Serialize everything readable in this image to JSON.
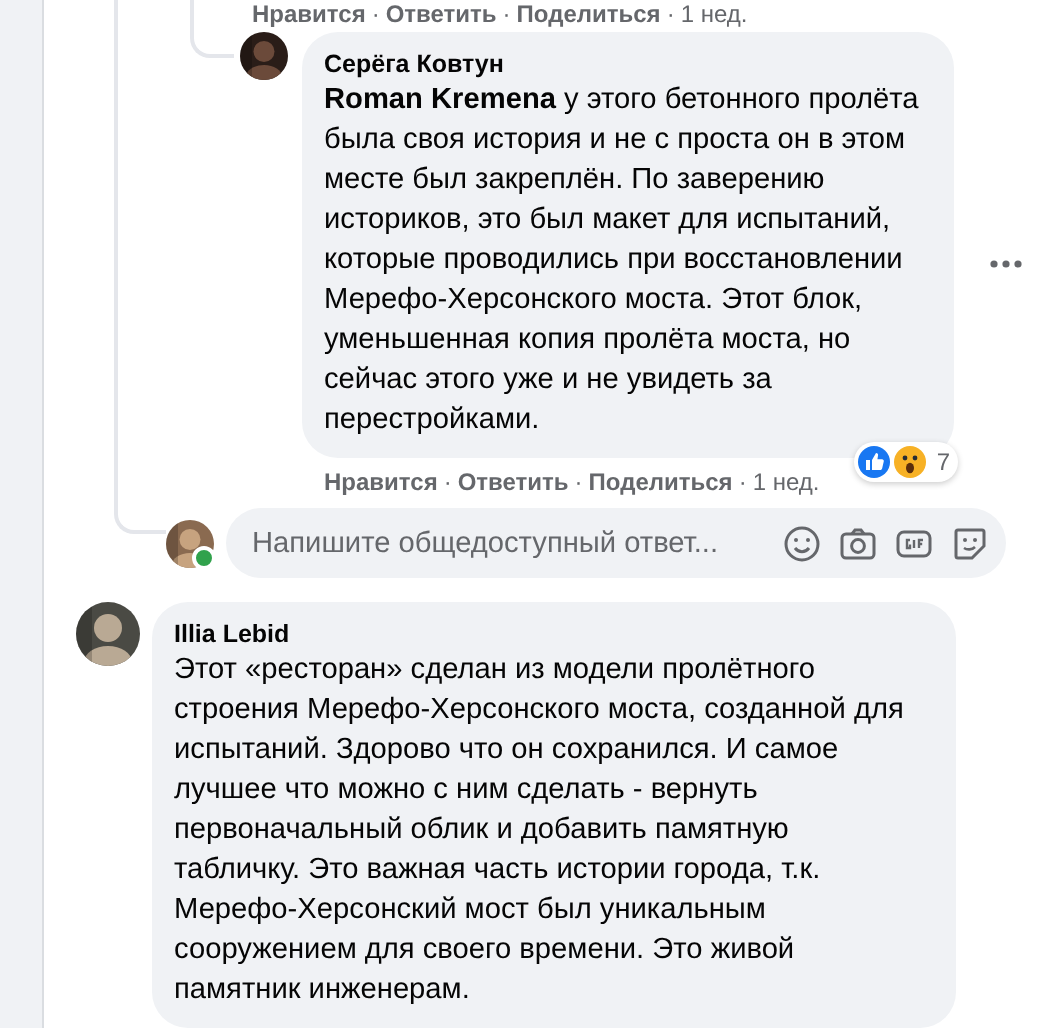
{
  "top_actions": {
    "like": "Нравится",
    "sep": "·",
    "reply": "Ответить",
    "share": "Поделиться",
    "time": "1 нед."
  },
  "reply_comment": {
    "author": "Серёга Ковтун",
    "mention": "Roman Kremena",
    "text": " у этого бетонного пролёта была своя история и не с проста он в этом месте был закреплён. По заверению историков, это был макет для испытаний, которые проводились при восстановлении Мерефо-Херсонского моста. Этот блок, уменьшенная копия пролёта моста, но сейчас этого уже и не увидеть за перестройками.",
    "reaction_count": "7",
    "actions": {
      "like": "Нравится",
      "sep": "·",
      "reply": "Ответить",
      "share": "Поделиться",
      "time": "1 нед."
    }
  },
  "reply_box": {
    "placeholder": "Напишите общедоступный ответ...",
    "online": true
  },
  "comment": {
    "author": "Illia Lebid",
    "text": "Этот «ресторан» сделан из модели пролётного строения Мерефо-Херсонского моста, созданной для испытаний. Здорово что он сохранился. И самое лучшее что можно с ним сделать - вернуть первоначальный облик и добавить памятную табличку. Это важная часть истории города, т.к. Мерефо-Херсонский мост был уникальным сооружением для своего времени. Это живой памятник инженерам."
  }
}
